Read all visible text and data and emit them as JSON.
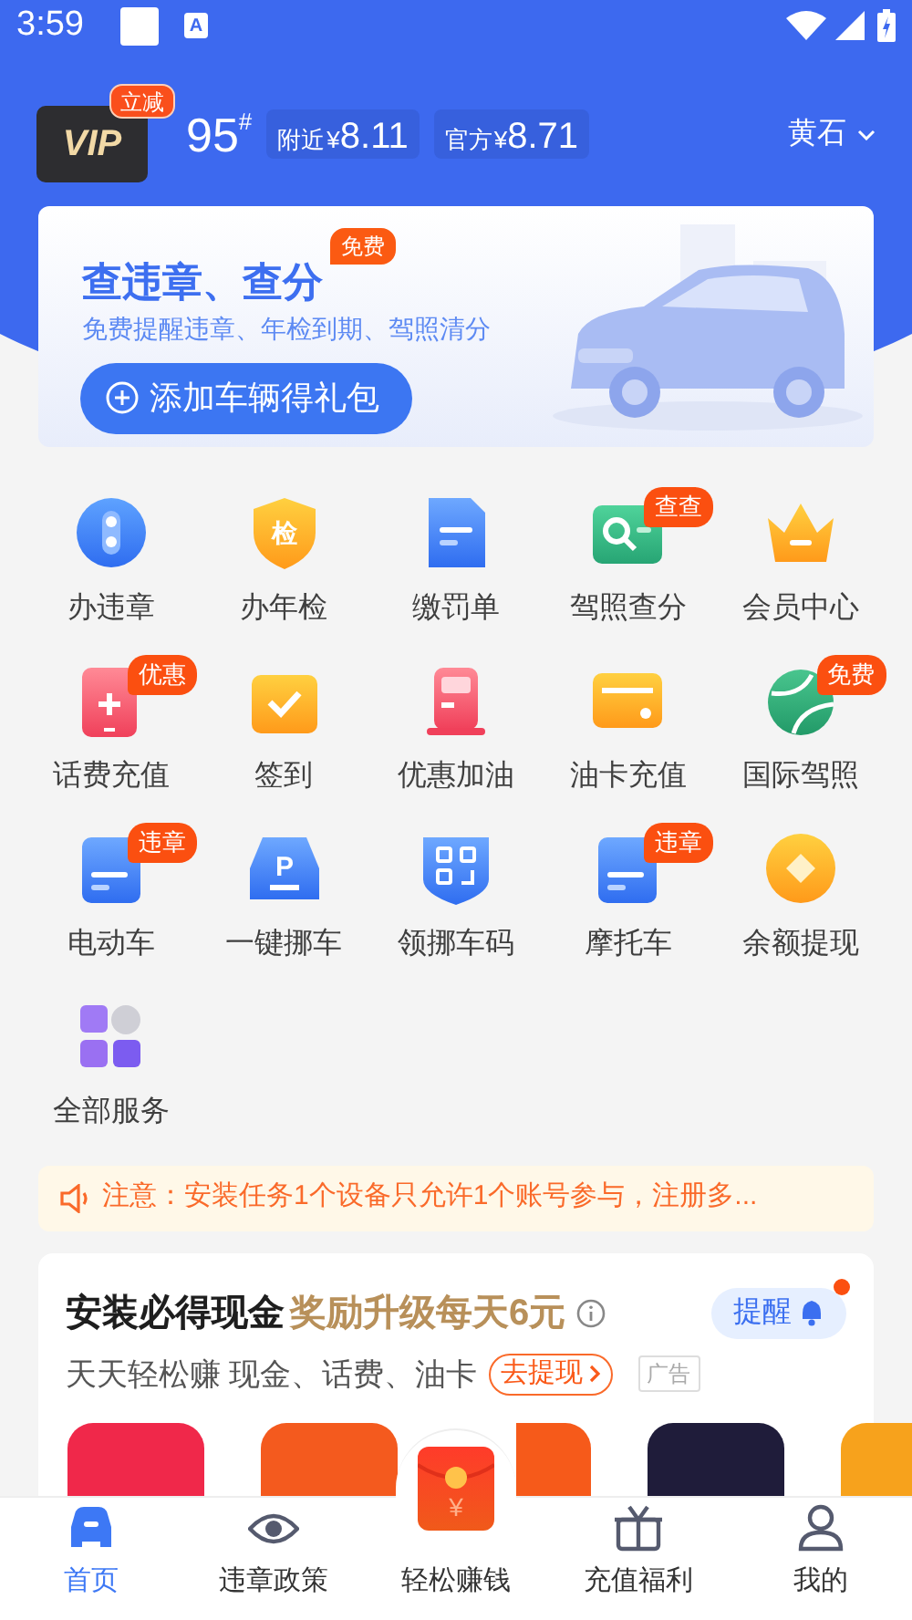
{
  "status_bar": {
    "time": "3:59",
    "keyboard_badge": "A"
  },
  "header": {
    "vip_label": "VIP",
    "vip_badge": "立减",
    "fuel_grade": "95",
    "fuel_mark": "#",
    "prices": [
      {
        "label": "附近",
        "currency": "¥",
        "value": "8.11"
      },
      {
        "label": "官方",
        "currency": "¥",
        "value": "8.71"
      }
    ],
    "city": "黄石"
  },
  "banner": {
    "title": "查违章、查分",
    "badge": "免费",
    "subtitle": "免费提醒违章、年检到期、驾照清分",
    "button": "添加车辆得礼包"
  },
  "services": [
    {
      "label": "办违章"
    },
    {
      "label": "办年检",
      "glyph": "检"
    },
    {
      "label": "缴罚单"
    },
    {
      "label": "驾照查分",
      "badge": "查查"
    },
    {
      "label": "会员中心"
    },
    {
      "label": "话费充值",
      "badge": "优惠"
    },
    {
      "label": "签到"
    },
    {
      "label": "优惠加油"
    },
    {
      "label": "油卡充值"
    },
    {
      "label": "国际驾照",
      "badge": "免费"
    },
    {
      "label": "电动车",
      "badge": "违章"
    },
    {
      "label": "一键挪车",
      "glyph": "P"
    },
    {
      "label": "领挪车码"
    },
    {
      "label": "摩托车",
      "badge": "违章"
    },
    {
      "label": "余额提现"
    },
    {
      "label": "全部服务"
    }
  ],
  "notice": "注意：安装任务1个设备只允许1个账号参与，注册多...",
  "promo": {
    "title": "安装必得现金",
    "highlight": "奖励升级每天6元",
    "remind_button": "提醒",
    "remind_dot": true,
    "subtitle": "天天轻松赚 现金、话费、油卡",
    "cash_button": "去提现",
    "ad_tag": "广告",
    "apps": [
      {
        "color": "#f0284a"
      },
      {
        "color": "#f45a1e"
      },
      {
        "color": "#f65a1a"
      },
      {
        "color": "#1f1c3a"
      },
      {
        "color": "#f7a21c"
      }
    ]
  },
  "bottom_nav": [
    {
      "label": "首页",
      "selected": true
    },
    {
      "label": "违章政策",
      "selected": false
    },
    {
      "label": "轻松赚钱",
      "selected": false,
      "glyph": "¥"
    },
    {
      "label": "充值福利",
      "selected": false
    },
    {
      "label": "我的",
      "selected": false
    }
  ]
}
